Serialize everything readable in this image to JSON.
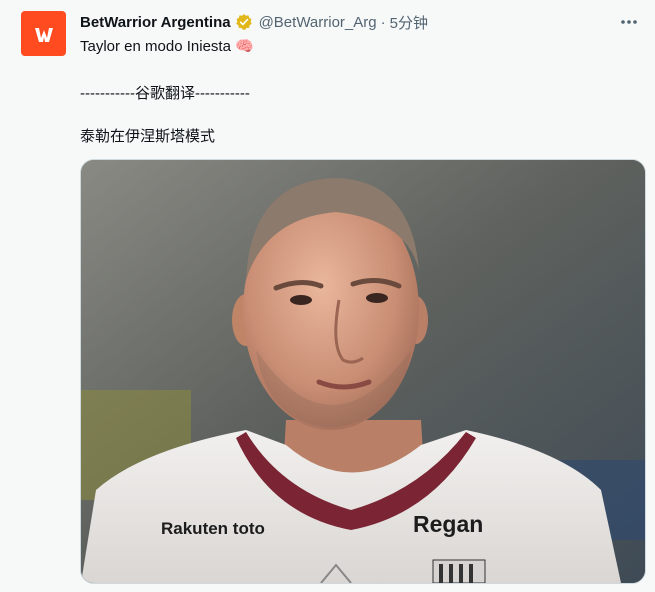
{
  "tweet": {
    "author": {
      "display_name": "BetWarrior Argentina",
      "handle": "@BetWarrior_Arg",
      "verified": true,
      "avatar_icon": "betwarrior-logo-icon",
      "avatar_color": "#ff4b1f"
    },
    "separator": "·",
    "time": "5分钟",
    "text": "Taylor en modo Iniesta 🧠",
    "translation_divider": "-----------谷歌翻译-----------",
    "translated_text": "泰勒在伊涅斯塔模式",
    "menu_icon": "more-icon",
    "media": {
      "kind": "photo",
      "jersey_texts": [
        "Rakuten toto",
        "Regan"
      ]
    }
  },
  "colors": {
    "text_primary": "#0f1419",
    "text_secondary": "#536471",
    "verified_gold": "#e2b719",
    "jersey_maroon": "#7a2434"
  }
}
